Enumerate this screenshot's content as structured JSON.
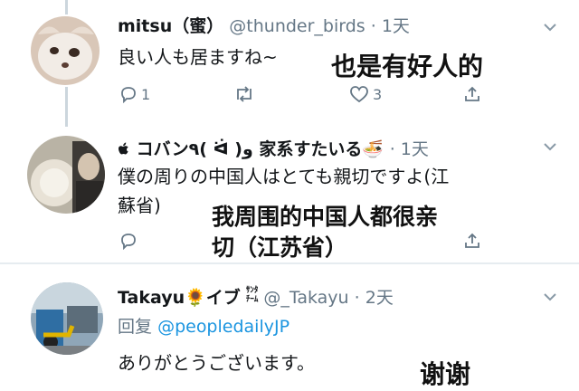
{
  "tweets": [
    {
      "name": "mitsu（蜜）",
      "handle": "@thunder_birds",
      "dot": "·",
      "time": "1天",
      "text": "良い人も居ますね~",
      "reply_count": "1",
      "like_count": "3",
      "annotation": "也是有好人的"
    },
    {
      "name": "コバン٩( ᐛ )و 家系すたいる🍜",
      "handle_prefix_icon": "apple-icon",
      "dot": "·",
      "time": "1天",
      "text_line1": "僕の周りの中国人はとても親切ですよ(江",
      "text_line2": "蘇省)",
      "annotation_line1": "我周围的中国人都很亲",
      "annotation_line2": "切（江苏省）"
    },
    {
      "name": "Takayu🌻イブ",
      "name_suffix": "ｻﾝﾀ\nﾁｰﾑ",
      "handle": "@_Takayu",
      "dot": "·",
      "time": "2天",
      "reply_label": "回复",
      "reply_target": "@peopledailyJP",
      "text": "ありがとうございます。",
      "annotation": "谢谢"
    }
  ],
  "colors": {
    "link": "#1b95e0",
    "muted": "#657786",
    "divider": "#e6ecf0",
    "text": "#14171a"
  }
}
